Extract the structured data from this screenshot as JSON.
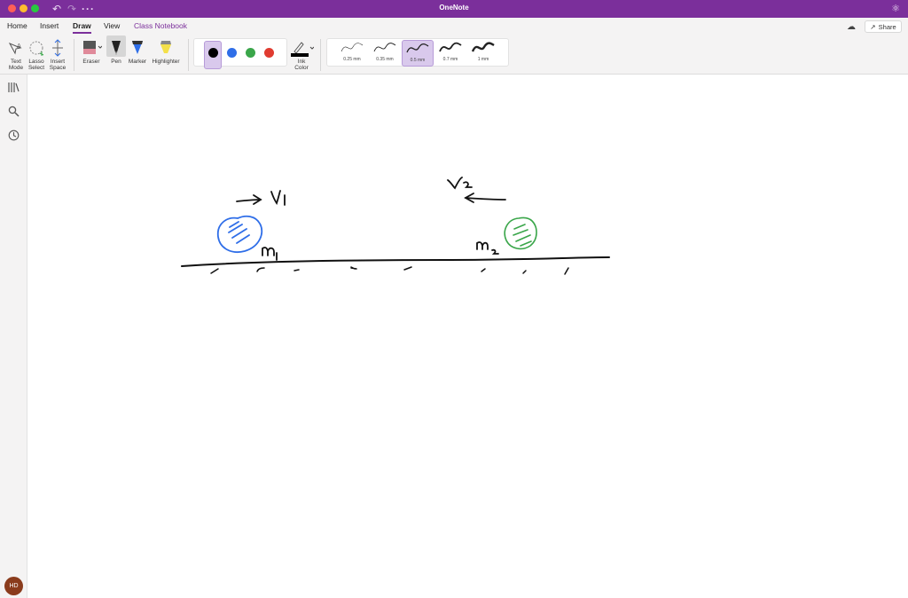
{
  "app": {
    "title": "OneNote"
  },
  "tabs": [
    {
      "label": "Home"
    },
    {
      "label": "Insert"
    },
    {
      "label": "Draw"
    },
    {
      "label": "View"
    },
    {
      "label": "Class Notebook"
    }
  ],
  "share": {
    "label": "Share"
  },
  "ribbon": {
    "text_mode": "Text\nMode",
    "lasso_select": "Lasso\nSelect",
    "insert_space": "Insert\nSpace",
    "eraser": "Eraser",
    "pen": "Pen",
    "marker": "Marker",
    "highlighter": "Highlighter",
    "ink_color": "Ink\nColor",
    "pen_colors": [
      "#000000",
      "#2f6ee8",
      "#3aa64a",
      "#e03b30"
    ],
    "selected_color": "#000000",
    "thickness": [
      "0.25 mm",
      "0.35 mm",
      "0.5 mm",
      "0.7 mm",
      "1 mm"
    ],
    "selected_thickness": "0.5 mm"
  },
  "sidebar": {
    "icons": [
      "notebooks-icon",
      "search-icon",
      "recent-icon"
    ],
    "avatar_initials": "HD"
  },
  "drawing": {
    "labels": [
      "v1",
      "v2",
      "m1",
      "m2"
    ],
    "ball_colors": {
      "ball1": "#2f6ee8",
      "ball2": "#3aa64a"
    }
  }
}
